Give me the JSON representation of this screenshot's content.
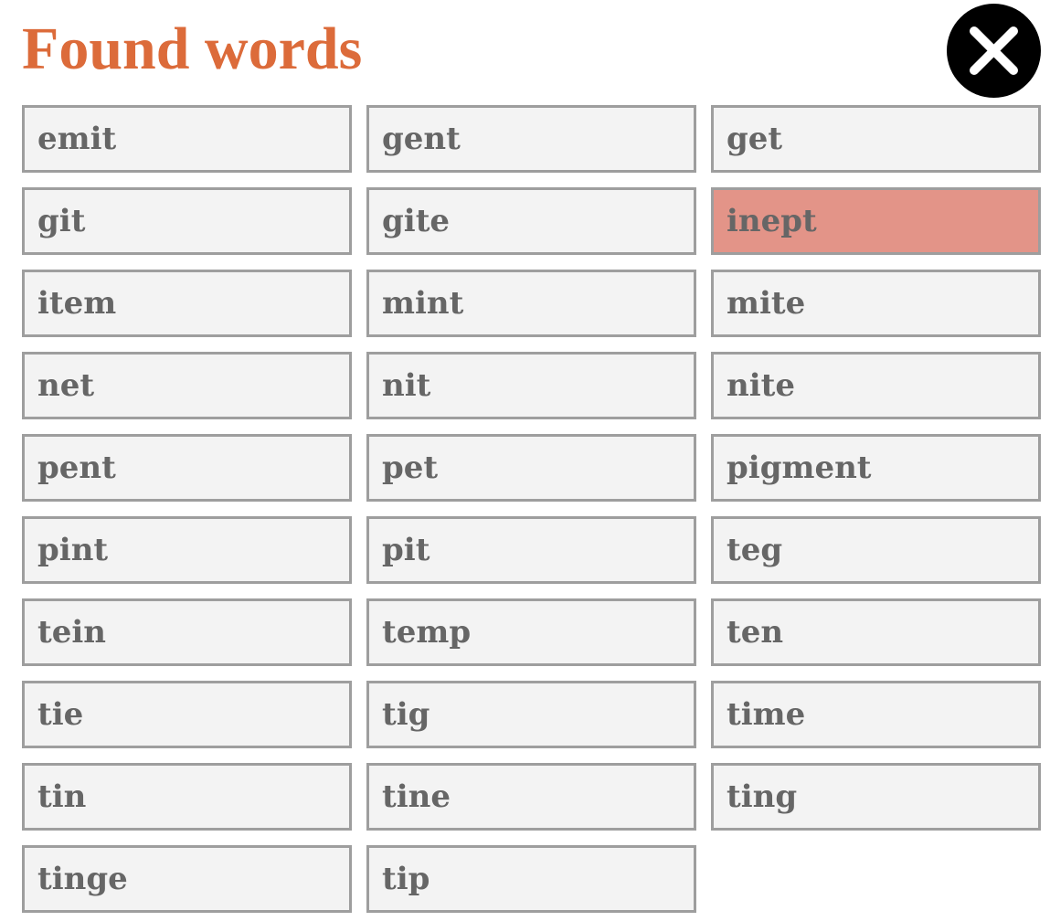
{
  "header": {
    "title": "Found words"
  },
  "colors": {
    "title": "#dc6b3a",
    "tile_background": "#f3f3f3",
    "tile_border": "#9e9e9e",
    "tile_text": "#666666",
    "highlight_background": "#e39488",
    "close_button": "#000000"
  },
  "close_button": {
    "icon": "close-icon"
  },
  "words": [
    {
      "text": "emit"
    },
    {
      "text": "gent"
    },
    {
      "text": "get"
    },
    {
      "text": "git"
    },
    {
      "text": "gite"
    },
    {
      "text": "inept",
      "highlighted": true
    },
    {
      "text": "item"
    },
    {
      "text": "mint"
    },
    {
      "text": "mite"
    },
    {
      "text": "net"
    },
    {
      "text": "nit"
    },
    {
      "text": "nite"
    },
    {
      "text": "pent"
    },
    {
      "text": "pet"
    },
    {
      "text": "pigment"
    },
    {
      "text": "pint"
    },
    {
      "text": "pit"
    },
    {
      "text": "teg"
    },
    {
      "text": "tein"
    },
    {
      "text": "temp"
    },
    {
      "text": "ten"
    },
    {
      "text": "tie"
    },
    {
      "text": "tig"
    },
    {
      "text": "time"
    },
    {
      "text": "tin"
    },
    {
      "text": "tine"
    },
    {
      "text": "ting"
    },
    {
      "text": "tinge"
    },
    {
      "text": "tip"
    }
  ]
}
